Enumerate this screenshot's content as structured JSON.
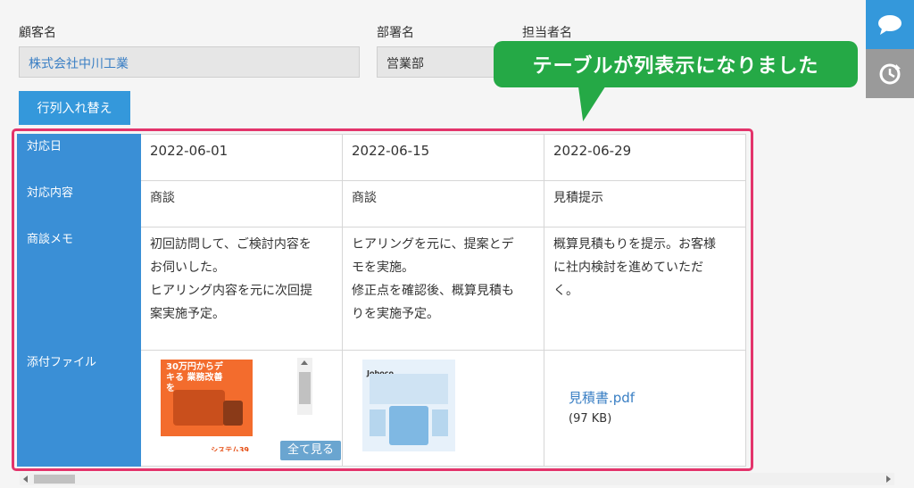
{
  "form": {
    "customer_label": "顧客名",
    "customer_value": "株式会社中川工業",
    "department_label": "部署名",
    "department_value": "営業部",
    "person_label": "担当者名"
  },
  "toolbar": {
    "swap_label": "行列入れ替え"
  },
  "callout": {
    "text": "テーブルが列表示になりました"
  },
  "side": {
    "comment_icon": "comment-icon",
    "history_icon": "history-icon",
    "accent": "#3498db"
  },
  "table": {
    "headers": {
      "date": "対応日",
      "content": "対応内容",
      "memo": "商談メモ",
      "attachment": "添付ファイル"
    },
    "columns": [
      {
        "date": "2022-06-01",
        "content": "商談",
        "memo_lines": [
          "初回訪問して、ご検討内容を",
          "お伺いした。",
          "ヒアリング内容を元に次回提",
          "案実施予定。"
        ]
      },
      {
        "date": "2022-06-15",
        "content": "商談",
        "memo_lines": [
          "ヒアリングを元に、提案とデ",
          "モを実施。",
          "修正点を確認後、概算見積も",
          "りを実施予定。"
        ]
      },
      {
        "date": "2022-06-29",
        "content": "見積提示",
        "memo_lines": [
          "概算見積もりを提示。お客様",
          "に社内検討を進めていただ",
          "く。"
        ]
      }
    ],
    "attachments": {
      "col1_thumb_text": "30万円からデキる 業務改善を",
      "col1_thumb_footer": "システム39",
      "col1_view_all": "全て見る",
      "col2_thumb_text": "Joboco",
      "col3_file_name": "見積書.pdf",
      "col3_file_size": "(97 KB)"
    }
  },
  "colors": {
    "header_bg": "#3a8fd6",
    "highlight": "#e3346b",
    "callout_bg": "#25a946"
  }
}
